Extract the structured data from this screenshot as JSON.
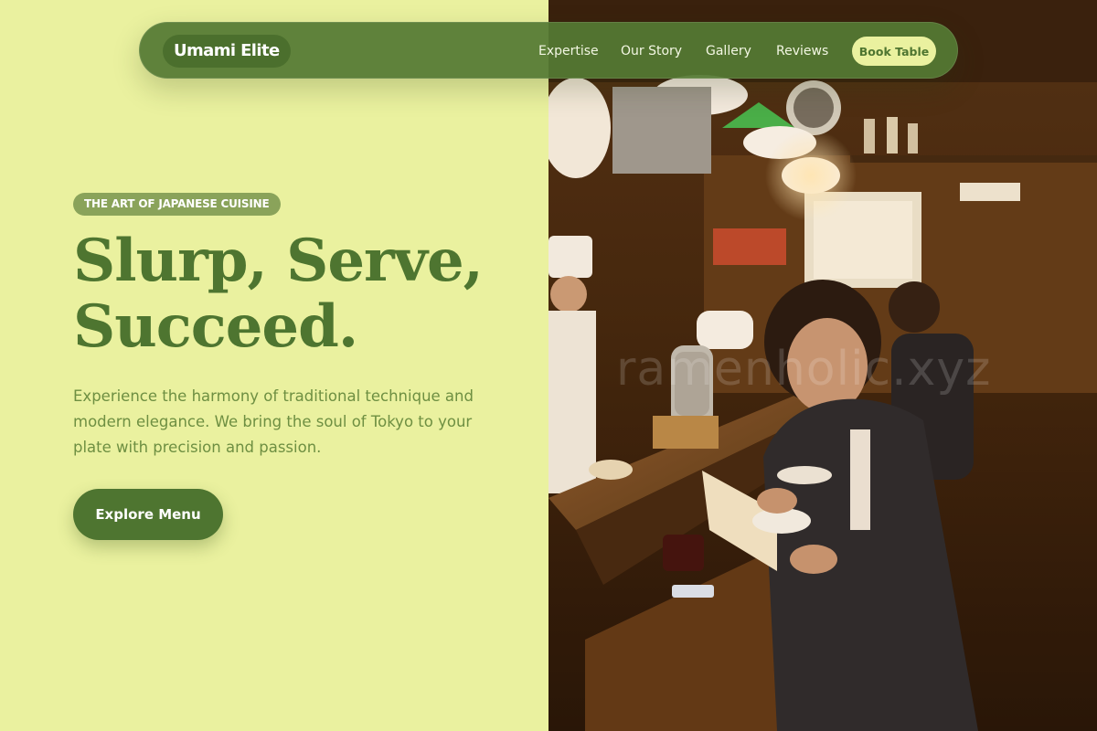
{
  "nav": {
    "brand": "Umami Elite",
    "links": [
      "Expertise",
      "Our Story",
      "Gallery",
      "Reviews"
    ],
    "cta_label": "Book Table"
  },
  "hero": {
    "eyebrow": "THE ART OF JAPANESE CUISINE",
    "headline_line1": "Slurp, Serve,",
    "headline_line2": "Succeed.",
    "description": "Experience the harmony of traditional technique and modern elegance. We bring the soul of Tokyo to your plate with precision and passion.",
    "cta_label": "Explore Menu"
  },
  "photo": {
    "watermark": "ramenholic.xyz"
  },
  "colors": {
    "background": "#eaf19f",
    "primary_green": "#4e7530",
    "nav_green": "#547a34",
    "eyebrow_green": "#8aa35a",
    "text_green": "#6e8f42"
  }
}
